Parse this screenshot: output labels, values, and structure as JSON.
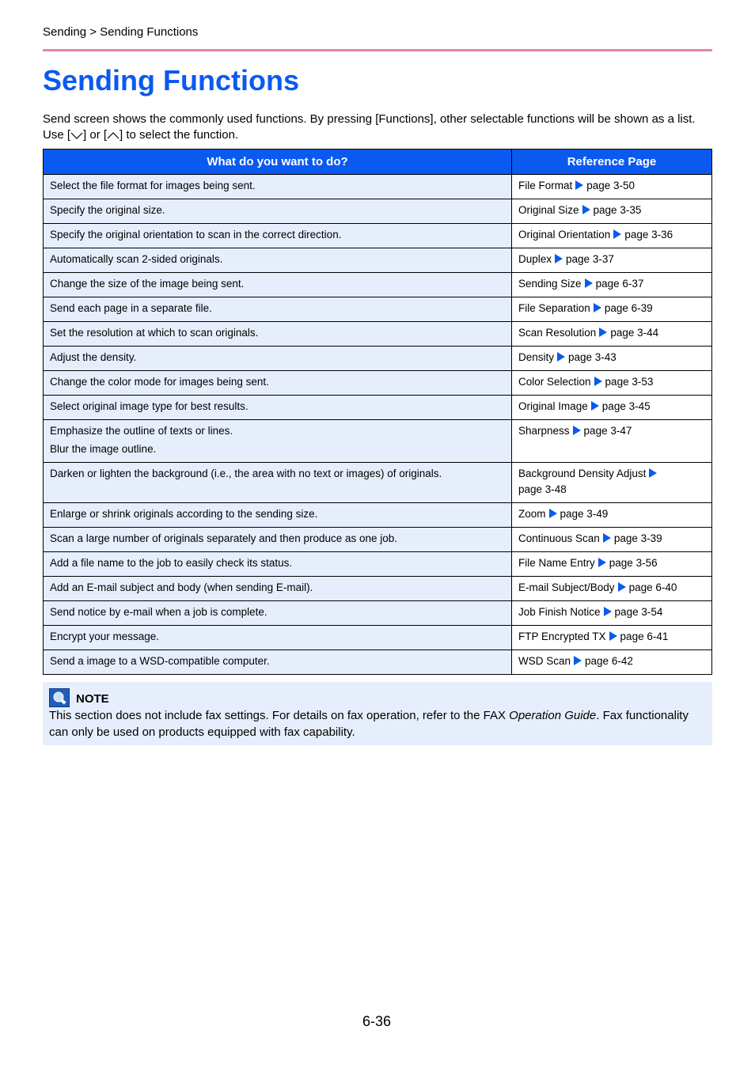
{
  "breadcrumb": "Sending > Sending Functions",
  "title": "Sending Functions",
  "intro": {
    "part1": "Send screen shows the commonly used functions. By pressing [Functions], other selectable functions will be shown as a list. Use [",
    "part2": "] or [",
    "part3": "] to select the function.",
    "down_key_icon": "chevron-down-icon",
    "up_key_icon": "chevron-up-icon"
  },
  "table": {
    "headers": [
      "What do you want to do?",
      "Reference Page"
    ],
    "rows": [
      {
        "what": [
          "Select the file format for images being sent."
        ],
        "ref": "File Format",
        "page": "page 3-50"
      },
      {
        "what": [
          "Specify the original size."
        ],
        "ref": "Original Size",
        "page": "page 3-35"
      },
      {
        "what": [
          "Specify the original orientation to scan in the correct direction."
        ],
        "ref": "Original Orientation",
        "page": "page 3-36"
      },
      {
        "what": [
          "Automatically scan 2-sided originals."
        ],
        "ref": "Duplex",
        "page": "page 3-37"
      },
      {
        "what": [
          "Change the size of the image being sent."
        ],
        "ref": "Sending Size",
        "page": "page 6-37"
      },
      {
        "what": [
          "Send each page in a separate file."
        ],
        "ref": "File Separation",
        "page": "page 6-39"
      },
      {
        "what": [
          "Set the resolution at which to scan originals."
        ],
        "ref": "Scan Resolution",
        "page": "page 3-44"
      },
      {
        "what": [
          "Adjust the density."
        ],
        "ref": "Density",
        "page": "page 3-43"
      },
      {
        "what": [
          "Change the color mode for images being sent."
        ],
        "ref": "Color Selection",
        "page": "page 3-53"
      },
      {
        "what": [
          "Select original image type for best results."
        ],
        "ref": "Original Image",
        "page": "page 3-45"
      },
      {
        "what": [
          "Emphasize the outline of texts or lines.",
          "Blur the image outline."
        ],
        "ref": "Sharpness",
        "page": "page 3-47"
      },
      {
        "what": [
          "Darken or lighten the background (i.e., the area with no text or images) of originals."
        ],
        "ref": "Background Density Adjust",
        "page": "page 3-48"
      },
      {
        "what": [
          "Enlarge or shrink originals according to the sending size."
        ],
        "ref": "Zoom",
        "page": "page 3-49"
      },
      {
        "what": [
          "Scan a large number of originals separately and then produce as one job."
        ],
        "ref": "Continuous Scan",
        "page": "page 3-39"
      },
      {
        "what": [
          "Add a file name to the job to easily check its status."
        ],
        "ref": "File Name Entry",
        "page": "page 3-56"
      },
      {
        "what": [
          "Add an E-mail subject and body (when sending E-mail)."
        ],
        "ref": "E-mail Subject/Body",
        "page": "page 6-40"
      },
      {
        "what": [
          "Send notice by e-mail when a job is complete."
        ],
        "ref": "Job Finish Notice",
        "page": "page 3-54"
      },
      {
        "what": [
          "Encrypt your message."
        ],
        "ref": "FTP Encrypted TX",
        "page": "page 6-41"
      },
      {
        "what": [
          "Send a image to a WSD-compatible computer."
        ],
        "ref": "WSD Scan",
        "page": "page 6-42"
      }
    ]
  },
  "note": {
    "icon": "note-icon",
    "heading": "NOTE",
    "text1": "This section does not include fax settings. For details on fax operation, refer to the FAX ",
    "text_italic": "Operation Guide",
    "text2": ". Fax functionality can only be used on products equipped with fax capability."
  },
  "page_number": "6-36",
  "colors": {
    "accent": "#0a5af0",
    "rule": "#ea85a4",
    "cell_bg": "#e6eefc"
  }
}
